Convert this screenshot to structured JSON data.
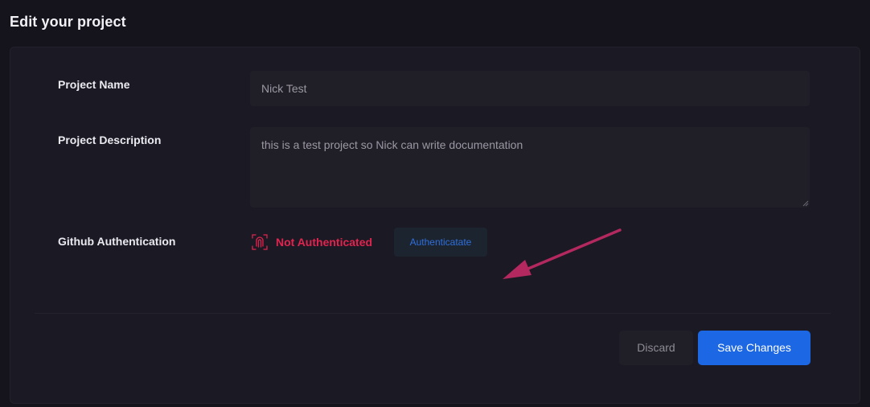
{
  "page": {
    "title": "Edit your project"
  },
  "form": {
    "project_name": {
      "label": "Project Name",
      "value": "Nick Test"
    },
    "project_description": {
      "label": "Project Description",
      "value": "this is a test project so Nick can write documentation"
    },
    "github_auth": {
      "label": "Github Authentication",
      "status": "Not Authenticated",
      "status_icon": "fingerprint-icon",
      "button_label": "Authenticatate"
    }
  },
  "actions": {
    "discard_label": "Discard",
    "save_label": "Save Changes"
  },
  "colors": {
    "background": "#15131c",
    "card": "#1b1923",
    "status_error": "#e0244f",
    "accent": "#1c67e3",
    "annotation_arrow": "#b3285f"
  }
}
